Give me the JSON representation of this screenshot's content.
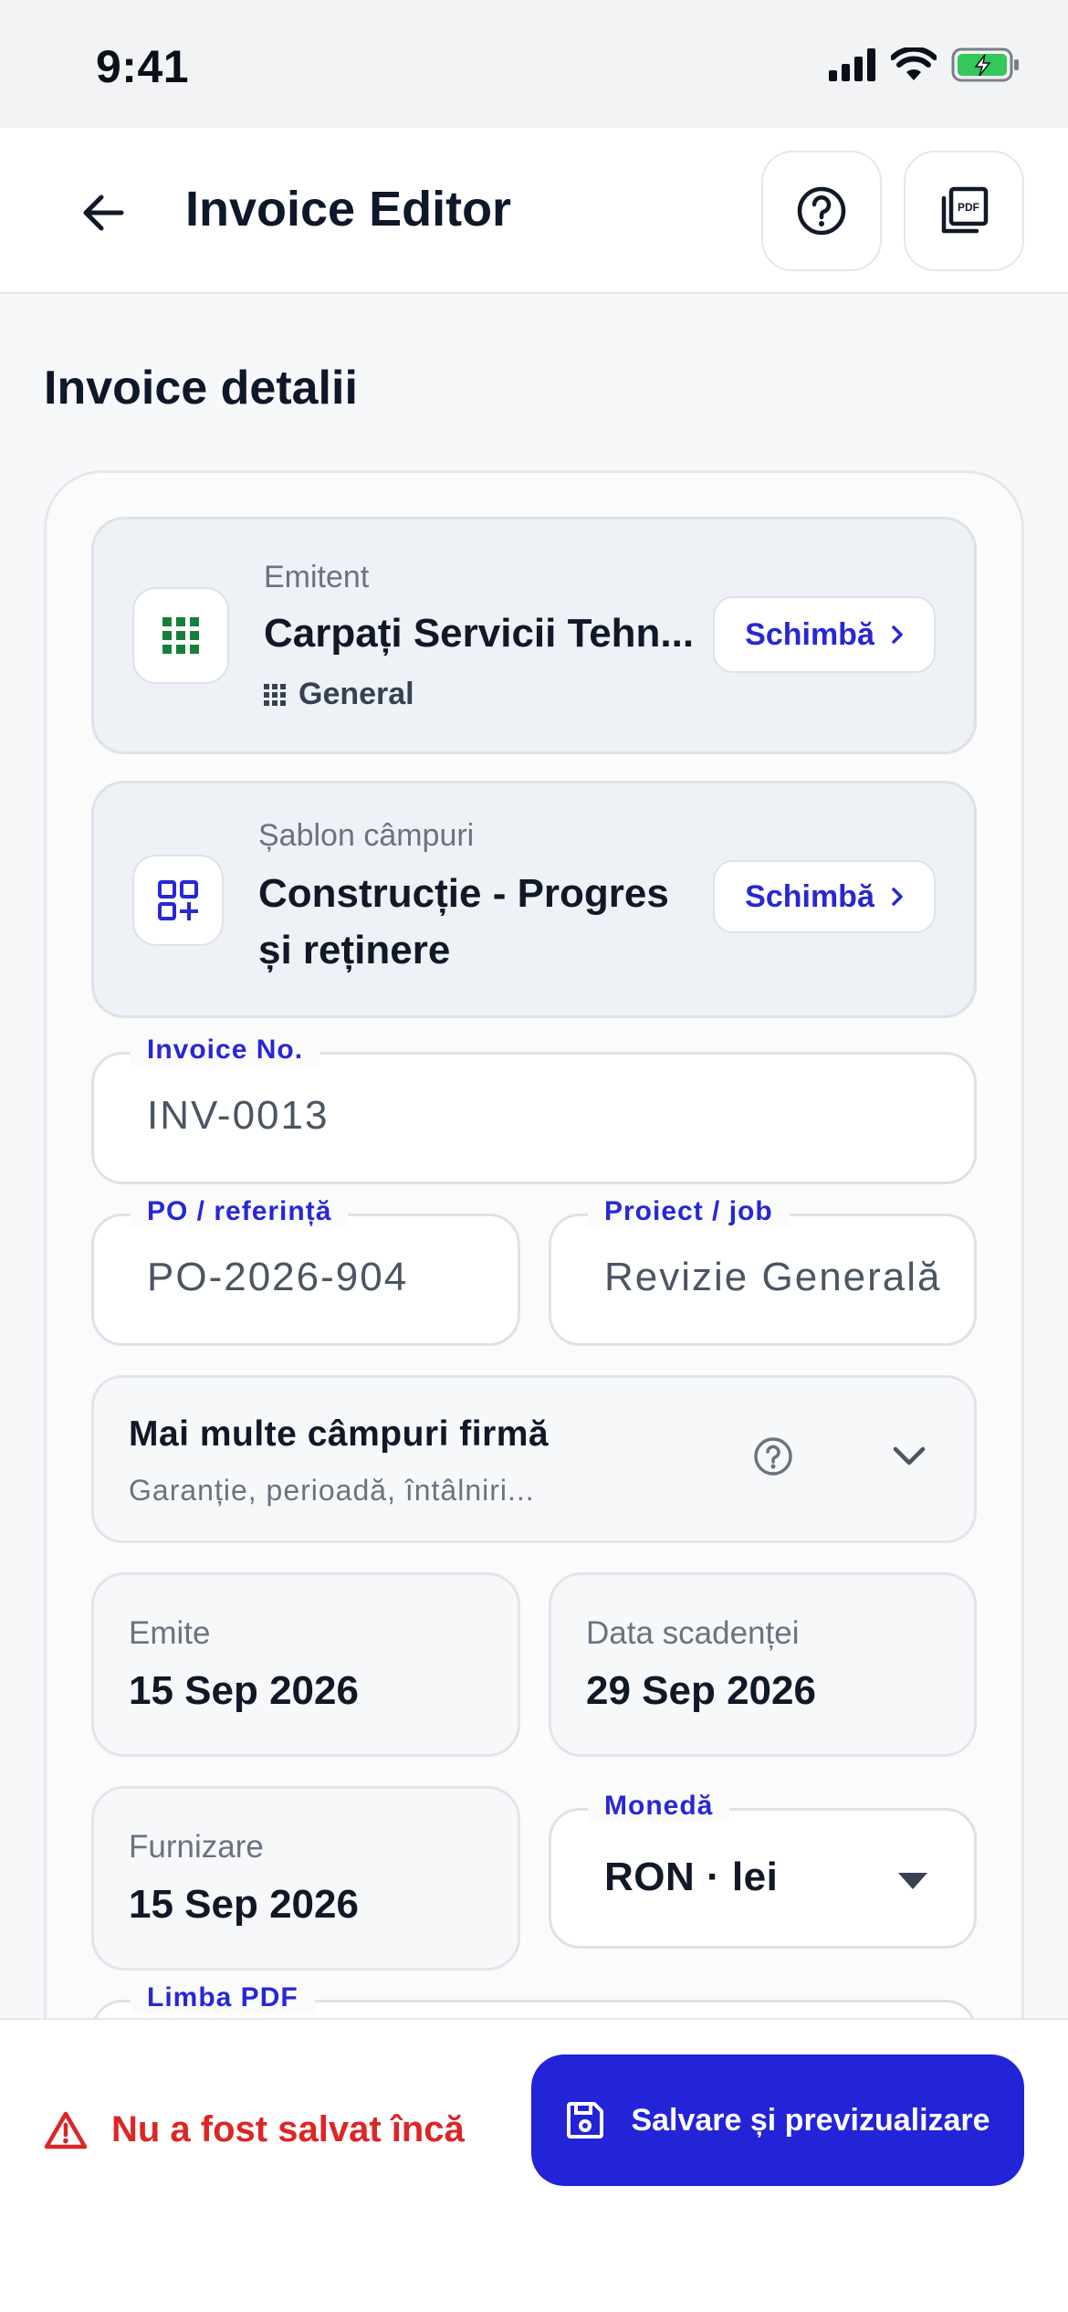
{
  "status_bar": {
    "time": "9:41"
  },
  "header": {
    "title": "Invoice Editor",
    "pdf_icon_text": "PDF"
  },
  "section": {
    "title": "Invoice detalii"
  },
  "emitent": {
    "label": "Emitent",
    "value": "Carpați Servicii Tehn...",
    "sub": "General",
    "change_label": "Schimbă"
  },
  "sablon": {
    "label": "Șablon câmpuri",
    "value_line1": "Construcție - Progres",
    "value_line2": "și reținere",
    "change_label": "Schimbă"
  },
  "invoice_no": {
    "label": "Invoice No.",
    "value": "INV-0013"
  },
  "po_ref": {
    "label": "PO / referință",
    "value": "PO-2026-904"
  },
  "project": {
    "label": "Proiect / job",
    "value": "Revizie Generală"
  },
  "more_fields": {
    "title": "Mai multe câmpuri firmă",
    "subtitle": "Garanție, perioadă, întâlniri..."
  },
  "dates": {
    "issued": {
      "label": "Emite",
      "value": "15 Sep 2026"
    },
    "due": {
      "label": "Data scadenței",
      "value": "29 Sep 2026"
    },
    "supply": {
      "label": "Furnizare",
      "value": "15 Sep 2026"
    }
  },
  "currency": {
    "label": "Monedă",
    "value": "RON · lei"
  },
  "pdf_language": {
    "label": "Limba PDF"
  },
  "bottom": {
    "unsaved_text": "Nu a fost salvat încă",
    "save_label": "Salvare și previzualizare"
  },
  "colors": {
    "accent": "#2323d8",
    "error": "#dc2626",
    "brand_green": "#15803d"
  }
}
